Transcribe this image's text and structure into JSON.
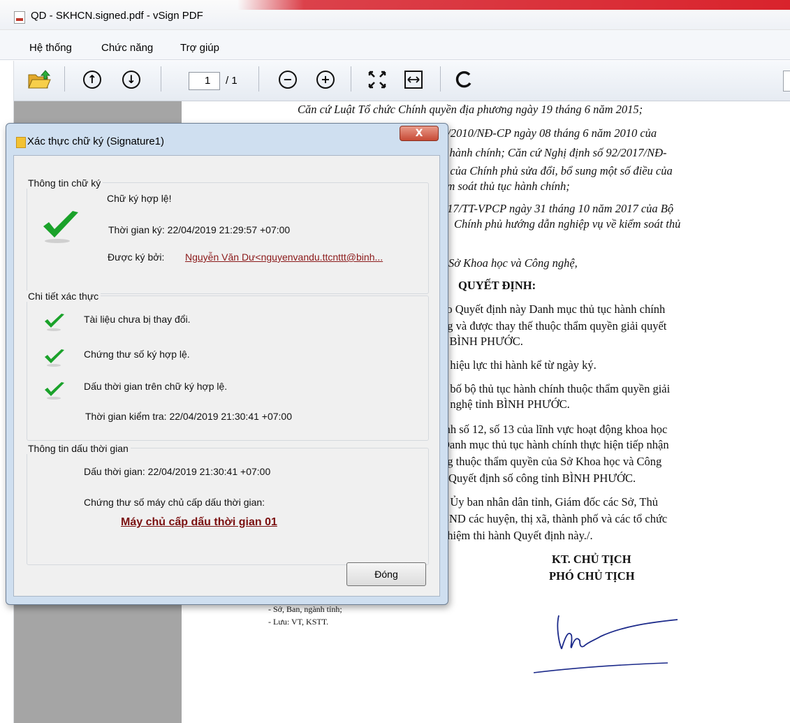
{
  "window": {
    "title": "QD - SKHCN.signed.pdf - vSign PDF"
  },
  "menu": [
    "Hệ thống",
    "Chức năng",
    "Trợ giúp"
  ],
  "toolbar": {
    "page_current": "1",
    "page_total": "/ 1"
  },
  "document": {
    "lines": [
      "Căn cứ Luật Tổ chức Chính quyền địa phương ngày 19 tháng 6 năm 2015;",
      "3/2010/NĐ-CP ngày 08 tháng 6 năm 2010 của",
      "c hành chính; Căn cứ Nghị định số 92/2017/NĐ-",
      "7 của Chính phủ sửa đổi, bổ sung một số điều của",
      "ểm soát thủ tục hành chính;",
      "017/TT-VPCP ngày 31 tháng 10 năm 2017 của Bộ",
      "Chính phủ hướng dẫn nghiệp vụ về kiểm soát thủ",
      "Sở Khoa học và Công nghệ,",
      "QUYẾT ĐỊNH:",
      "eo Quyết định này Danh mục thủ tục hành chính",
      "ng và được thay thế thuộc thẩm quyền giải quyết",
      "ệ BÌNH PHƯỚC.",
      "ó hiệu lực thi hành kể từ ngày ký.",
      "g bố bộ thủ tục hành chính thuộc thẩm quyền giải",
      "g nghệ tỉnh BÌNH PHƯỚC.",
      "ính số 12, số 13 của lĩnh vực hoạt động khoa học",
      "Danh mục thủ tục hành chính thực hiện tiếp nhận",
      "ng thuộc thẩm quyền của Sở Khoa học và Công",
      "Quyết định số công tỉnh BÌNH PHƯỚC.",
      "g Ủy ban nhân dân tỉnh, Giám đốc các Sở, Thủ",
      "BND các huyện, thị xã, thành phố và các tổ chức",
      "nhiệm thi hành Quyết định này./.",
      "KT. CHỦ TỊCH",
      "PHÓ CHỦ TỊCH",
      "- Sở, Ban, ngành tỉnh;",
      "- Lưu: VT, KSTT."
    ]
  },
  "dialog": {
    "title": "Xác thực chữ ký (Signature1)",
    "close_glyph": "X",
    "signature_info": {
      "heading": "Thông tin chữ ký",
      "status": "Chữ ký hợp lệ!",
      "sign_time": "Thời gian ký: 22/04/2019 21:29:57 +07:00",
      "signed_by_label": "Được ký bởi:",
      "signed_by_value": "Nguyễn Văn Dư<nguyenvandu.ttcnttt@binh..."
    },
    "verification": {
      "heading": "Chi tiết xác thực",
      "items": [
        "Tài liệu chưa bị thay đổi.",
        "Chứng thư số ký hợp lệ.",
        "Dấu thời gian trên chữ ký hợp lệ."
      ],
      "check_time": "Thời gian kiểm tra: 22/04/2019 21:30:41 +07:00"
    },
    "timestamp": {
      "heading": "Thông tin dấu thời gian",
      "time": "Dấu thời gian: 22/04/2019 21:30:41 +07:00",
      "cert_label": "Chứng thư số máy chủ cấp dấu thời gian:",
      "server": "Máy chủ cấp dấu thời gian 01"
    },
    "close_button": "Đóng"
  },
  "colors": {
    "accent_red": "#d9232c",
    "check_green": "#1aa22a",
    "link": "#8b1a1a"
  }
}
